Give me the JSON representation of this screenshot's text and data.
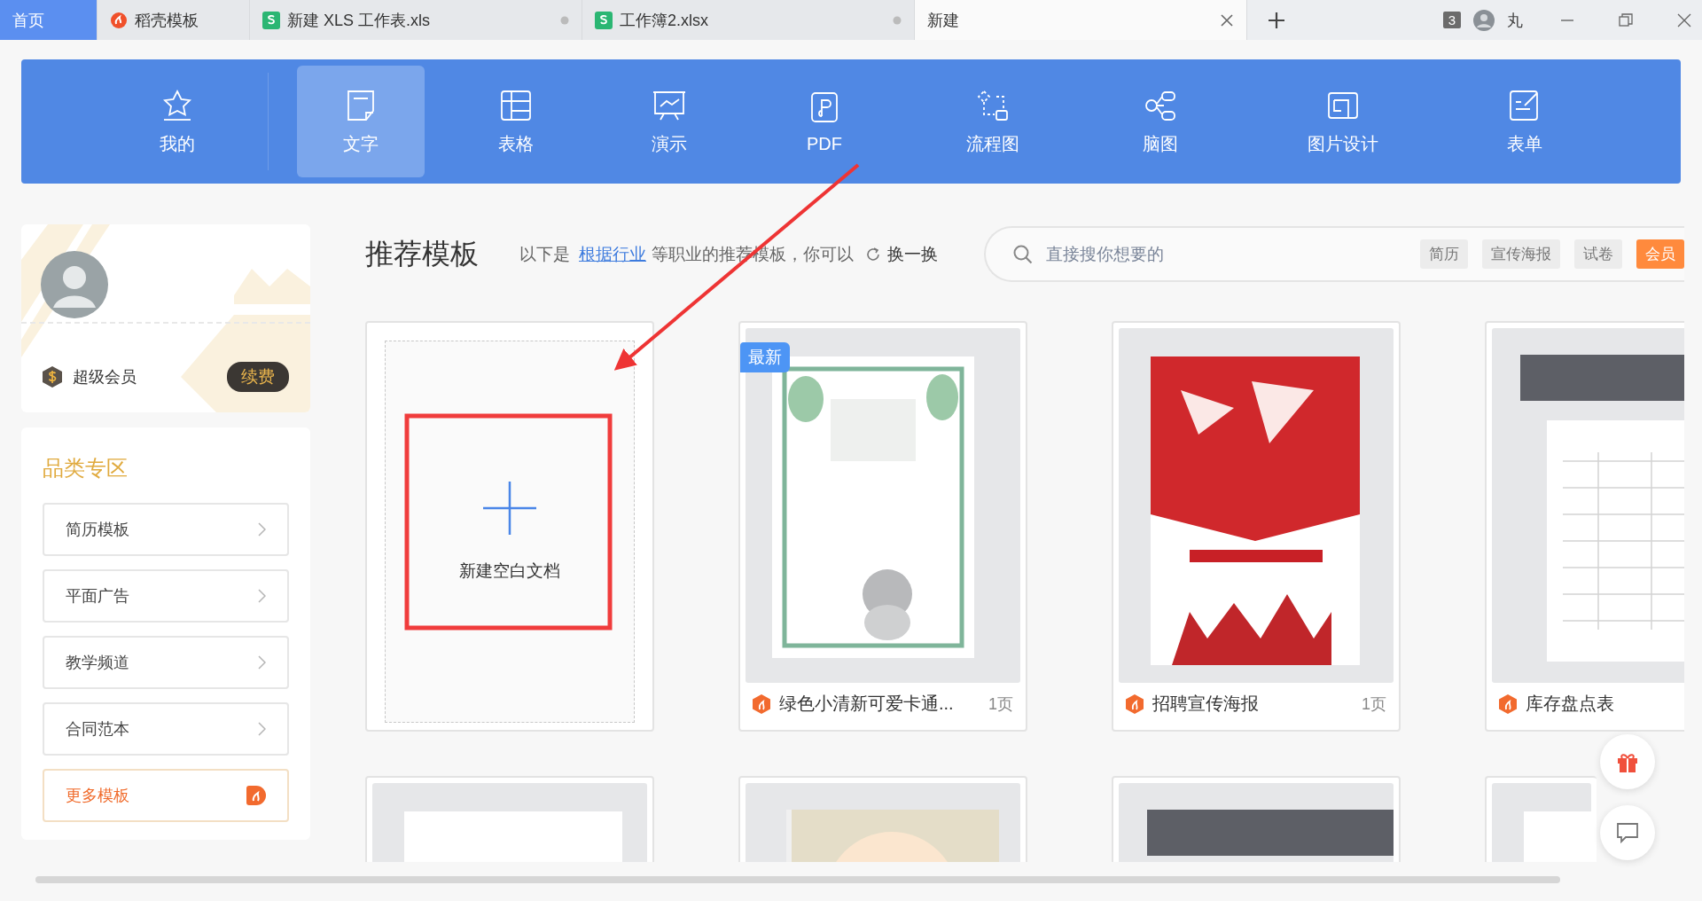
{
  "tabs": [
    {
      "label": "首页",
      "kind": "home",
      "selected": false
    },
    {
      "label": "稻壳模板",
      "kind": "docer",
      "selected": false
    },
    {
      "label": "新建 XLS 工作表.xls",
      "kind": "sheet",
      "selected": false
    },
    {
      "label": "工作簿2.xlsx",
      "kind": "sheet",
      "selected": false
    },
    {
      "label": "新建",
      "kind": "page",
      "selected": true
    }
  ],
  "window_count": "3",
  "user_name": "丸",
  "categories": [
    {
      "label": "我的",
      "selected": false
    },
    {
      "label": "文字",
      "selected": true
    },
    {
      "label": "表格",
      "selected": false
    },
    {
      "label": "演示",
      "selected": false
    },
    {
      "label": "PDF",
      "selected": false
    },
    {
      "label": "流程图",
      "selected": false
    },
    {
      "label": "脑图",
      "selected": false
    },
    {
      "label": "图片设计",
      "selected": false
    },
    {
      "label": "表单",
      "selected": false
    }
  ],
  "member": {
    "level": "超级会员",
    "renew": "续费"
  },
  "zone": {
    "title": "品类专区",
    "items": [
      "简历模板",
      "平面广告",
      "教学频道",
      "合同范本"
    ],
    "more": "更多模板"
  },
  "recommend": {
    "title": "推荐模板",
    "intro_prefix": "以下是",
    "link": "根据行业",
    "intro_suffix": "等职业的推荐模板，你可以",
    "refresh": "换一换"
  },
  "search": {
    "placeholder": "直接搜你想要的",
    "tags": [
      {
        "label": "简历",
        "kind": "tag"
      },
      {
        "label": "宣传海报",
        "kind": "tag"
      },
      {
        "label": "试卷",
        "kind": "tag"
      },
      {
        "label": "会员",
        "kind": "vip"
      }
    ]
  },
  "templates": [
    {
      "kind": "blank",
      "label": "新建空白文档"
    },
    {
      "kind": "template",
      "title": "绿色小清新可爱卡通...",
      "pages": "1页",
      "badge": "最新"
    },
    {
      "kind": "template",
      "title": "招聘宣传海报",
      "pages": "1页"
    },
    {
      "kind": "template",
      "title": "库存盘点表"
    },
    {
      "kind": "preview"
    },
    {
      "kind": "preview"
    },
    {
      "kind": "preview"
    },
    {
      "kind": "preview"
    }
  ]
}
